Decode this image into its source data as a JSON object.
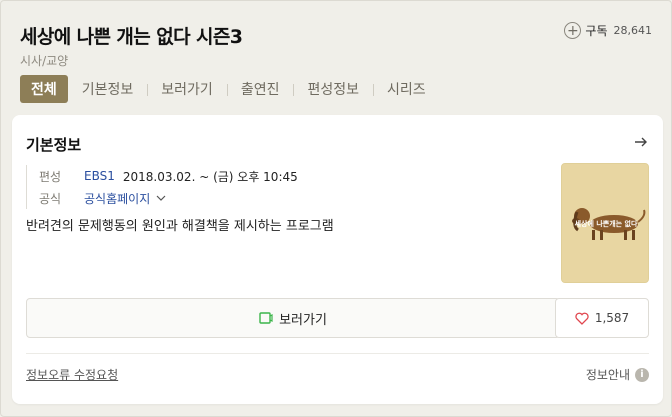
{
  "program": {
    "title": "세상에 나쁜 개는 없다 시즌3",
    "genre": "시사/교양"
  },
  "subscribe": {
    "icon": "plus-circle-icon",
    "label": "구독",
    "count": "28,641"
  },
  "tabs": [
    {
      "label": "전체",
      "active": true
    },
    {
      "label": "기본정보",
      "active": false
    },
    {
      "label": "보러가기",
      "active": false
    },
    {
      "label": "출연진",
      "active": false
    },
    {
      "label": "편성정보",
      "active": false
    },
    {
      "label": "시리즈",
      "active": false
    }
  ],
  "card": {
    "title": "기본정보",
    "arrow_icon": "arrow-right-icon",
    "schedule": {
      "key": "편성",
      "channel": "EBS1",
      "value": "2018.03.02. ~  (금) 오후 10:45"
    },
    "official": {
      "key": "공식",
      "link": "공식홈페이지"
    },
    "description": "반려견의 문제행동의 원인과 해결책을 제시하는 프로그램",
    "poster_title": "세상에 나쁜개는 없다",
    "watch_button": {
      "label": "보러가기",
      "icon": "play-icon",
      "icon_color": "#3bb54a"
    },
    "like_button": {
      "icon": "heart-icon",
      "count": "1,587",
      "icon_color": "#e0464e"
    },
    "report_link": "정보오류 수정요청",
    "info_guide": {
      "label": "정보안내",
      "icon": "info-icon"
    }
  },
  "colors": {
    "background": "#f0efe9",
    "active_tab": "#8d7e57",
    "link": "#2b4f9f"
  }
}
